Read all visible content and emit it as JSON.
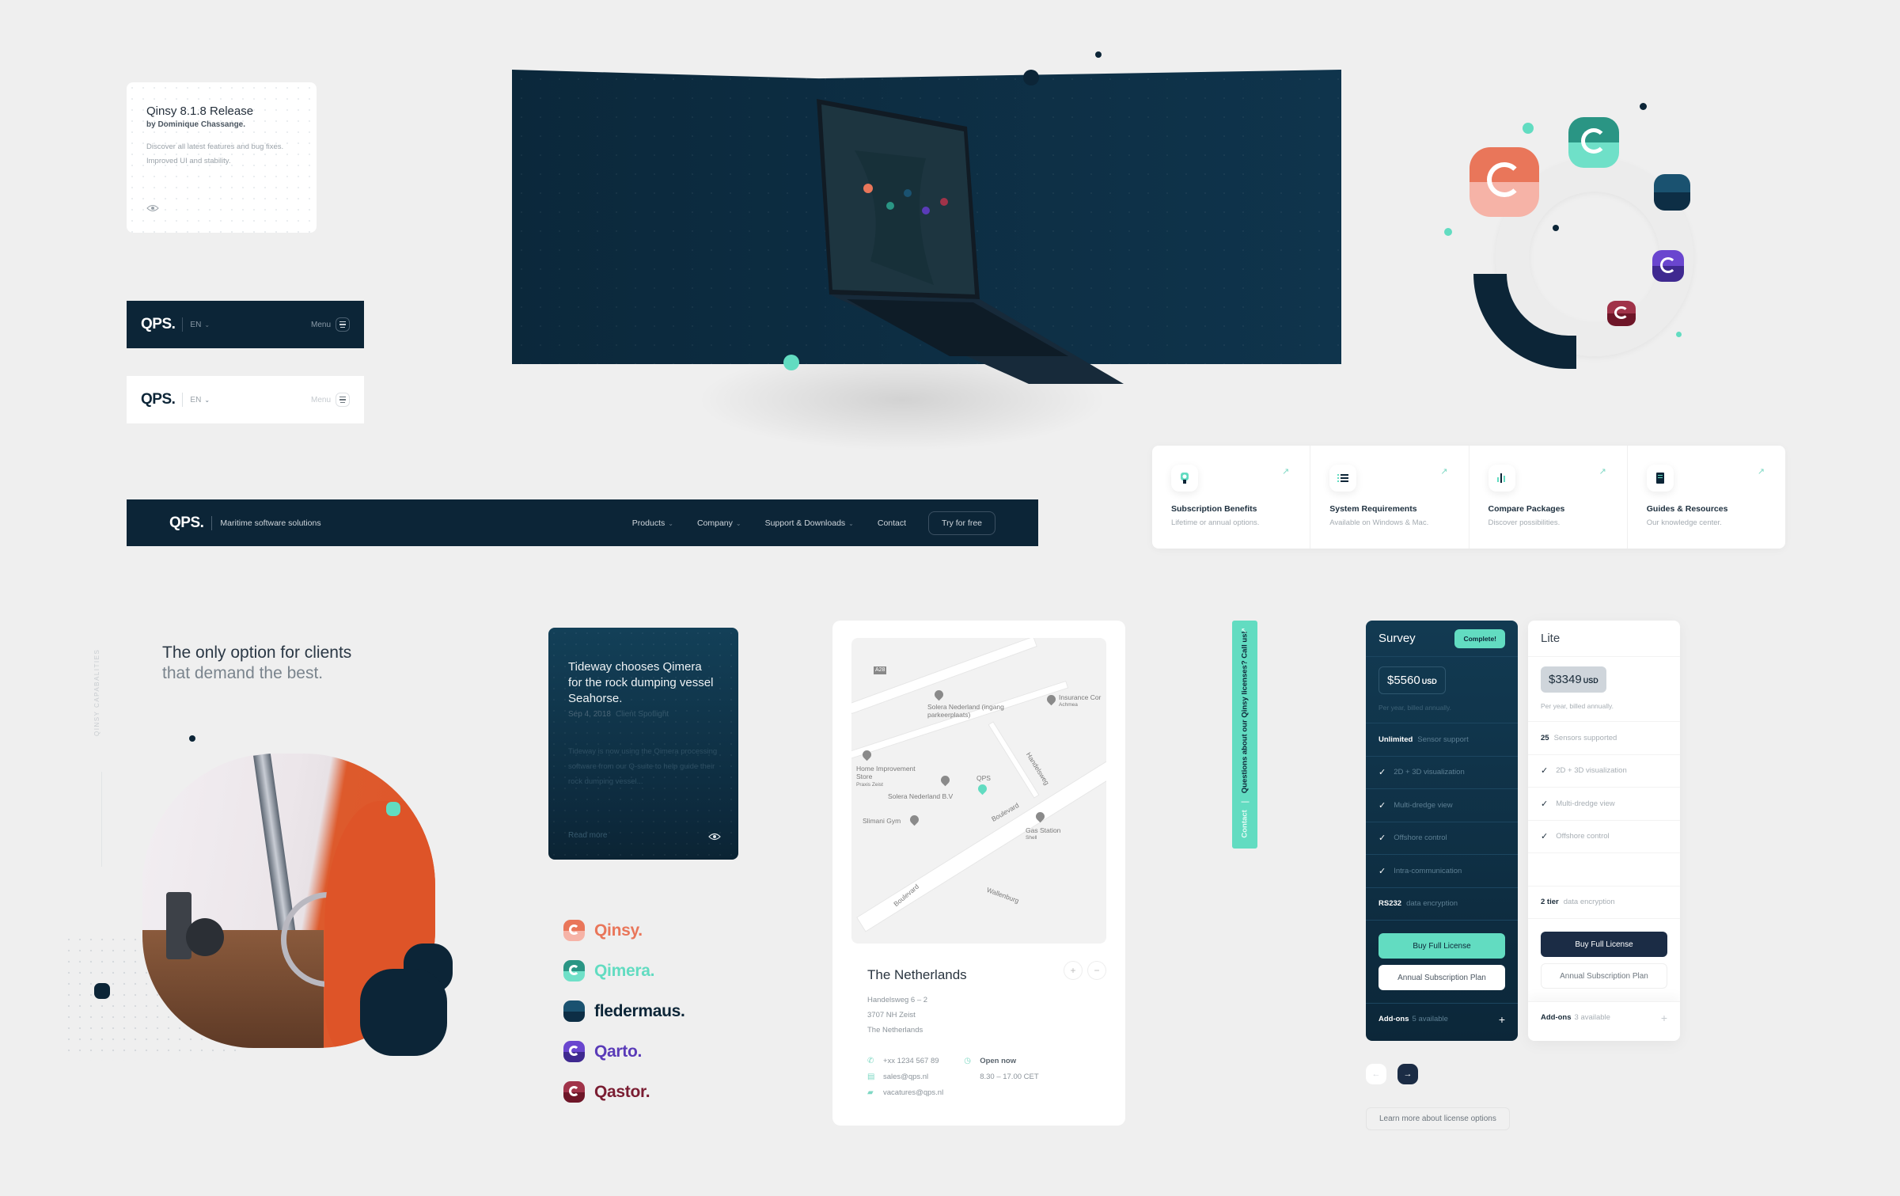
{
  "release_card": {
    "title": "Qinsy 8.1.8 Release",
    "author": "by Dominique Chassange.",
    "description": "Discover all latest features and bug fixes. Improved UI and stability.",
    "icon": "eye-icon"
  },
  "mobile_header_dark": {
    "logo": "QPS.",
    "language": "EN",
    "menu_label": "Menu"
  },
  "mobile_header_light": {
    "logo": "QPS.",
    "language": "EN",
    "menu_label": "Menu"
  },
  "main_nav": {
    "logo": "QPS.",
    "tagline": "Maritime software solutions",
    "links": [
      {
        "label": "Products",
        "dropdown": true
      },
      {
        "label": "Company",
        "dropdown": true
      },
      {
        "label": "Support & Downloads",
        "dropdown": true
      },
      {
        "label": "Contact",
        "dropdown": false
      }
    ],
    "cta": "Try for free"
  },
  "quick_links": [
    {
      "title": "Subscription Benefits",
      "subtitle": "Lifetime or annual options.",
      "icon": "badge-icon"
    },
    {
      "title": "System Requirements",
      "subtitle": "Available on Windows & Mac.",
      "icon": "list-icon"
    },
    {
      "title": "Compare Packages",
      "subtitle": "Discover possibilities.",
      "icon": "bar-chart-icon"
    },
    {
      "title": "Guides & Resources",
      "subtitle": "Our knowledge center.",
      "icon": "book-icon"
    }
  ],
  "capabilities": {
    "vertical_label": "QINSY CAPABALITIES",
    "headline_line1": "The only option for clients",
    "headline_line2": "that demand the best."
  },
  "story_card": {
    "title": "Tideway chooses Qimera for the rock dumping vessel Seahorse.",
    "date": "Sep 4, 2018",
    "category": "Client Spotlight",
    "excerpt": "Tideway is now using the Qimera processing software from our Q-suite to help guide their rock dumping vessel...",
    "read_more": "Read more"
  },
  "products": [
    {
      "name": "Qinsy.",
      "color": "#e9765a",
      "top": "#e9765a",
      "bottom": "#f6b3a7"
    },
    {
      "name": "Qimera.",
      "color": "#62dcc1",
      "top": "#2a9584",
      "bottom": "#6fe0c8"
    },
    {
      "name": "fledermaus.",
      "color": "#0c2537",
      "top": "#1a5270",
      "bottom": "#0d2e45"
    },
    {
      "name": "Qarto.",
      "color": "#5a3bb8",
      "top": "#6a46cf",
      "bottom": "#3f2990"
    },
    {
      "name": "Qastor.",
      "color": "#7a1d32",
      "top": "#a03349",
      "bottom": "#6e1628"
    }
  ],
  "contact": {
    "map_labels": {
      "road_a": "A28",
      "poi1": "Solera Nederland (ingang parkeerplaats)",
      "poi2": "Insurance Cor",
      "poi2_sub": "Achmea",
      "poi3": "Home Improvement Store",
      "poi3_sub": "Praxis Zeist",
      "poi4": "Solera Nederland B.V",
      "qps": "QPS",
      "poi5": "Slimani Gym",
      "poi6": "Gas Station",
      "poi6_sub": "Shell",
      "street1": "Boulevard",
      "street2": "Handelsweg",
      "street3": "Wallenburg"
    },
    "country": "The Netherlands",
    "address": [
      "Handelsweg 6 – 2",
      "3707 NH Zeist",
      "The Netherlands"
    ],
    "phone": "+xx 1234 567 89",
    "email_sales": "sales@qps.nl",
    "email_jobs": "vacatures@qps.nl",
    "status": "Open now",
    "hours": "8.30 – 17.00 CET",
    "zoom_in": "+",
    "zoom_out": "−"
  },
  "side_tab": {
    "label": "Contact",
    "question": "Questions about our Qinsy licenses? Call us!"
  },
  "plans": [
    {
      "name": "Survey",
      "badge": "Complete!",
      "price": "$5560",
      "currency": "USD",
      "billing": "Per year, billed annually.",
      "sensor_bold": "Unlimited",
      "sensor_text": "Sensor support",
      "features": [
        "2D + 3D visualization",
        "Multi-dredge view",
        "Offshore control",
        "Intra-communication"
      ],
      "encryption_bold": "RS232",
      "encryption_text": "data encryption",
      "buy": "Buy Full License",
      "subscription": "Annual Subscription Plan",
      "addons_label": "Add-ons",
      "addons_count": "5 available"
    },
    {
      "name": "Lite",
      "price": "$3349",
      "currency": "USD",
      "billing": "Per year, billed annually.",
      "sensor_bold": "25",
      "sensor_text": "Sensors supported",
      "features": [
        "2D + 3D visualization",
        "Multi-dredge view",
        "Offshore control"
      ],
      "encryption_bold": "2 tier",
      "encryption_text": "data encryption",
      "buy": "Buy Full License",
      "subscription": "Annual Subscription Plan",
      "addons_label": "Add-ons",
      "addons_count": "3 available"
    }
  ],
  "pager": {
    "prev": "←",
    "next": "→"
  },
  "learn_more": "Learn more about license options",
  "colors": {
    "navy": "#0c2537",
    "accent": "#62dcc1",
    "background": "#efefef"
  }
}
